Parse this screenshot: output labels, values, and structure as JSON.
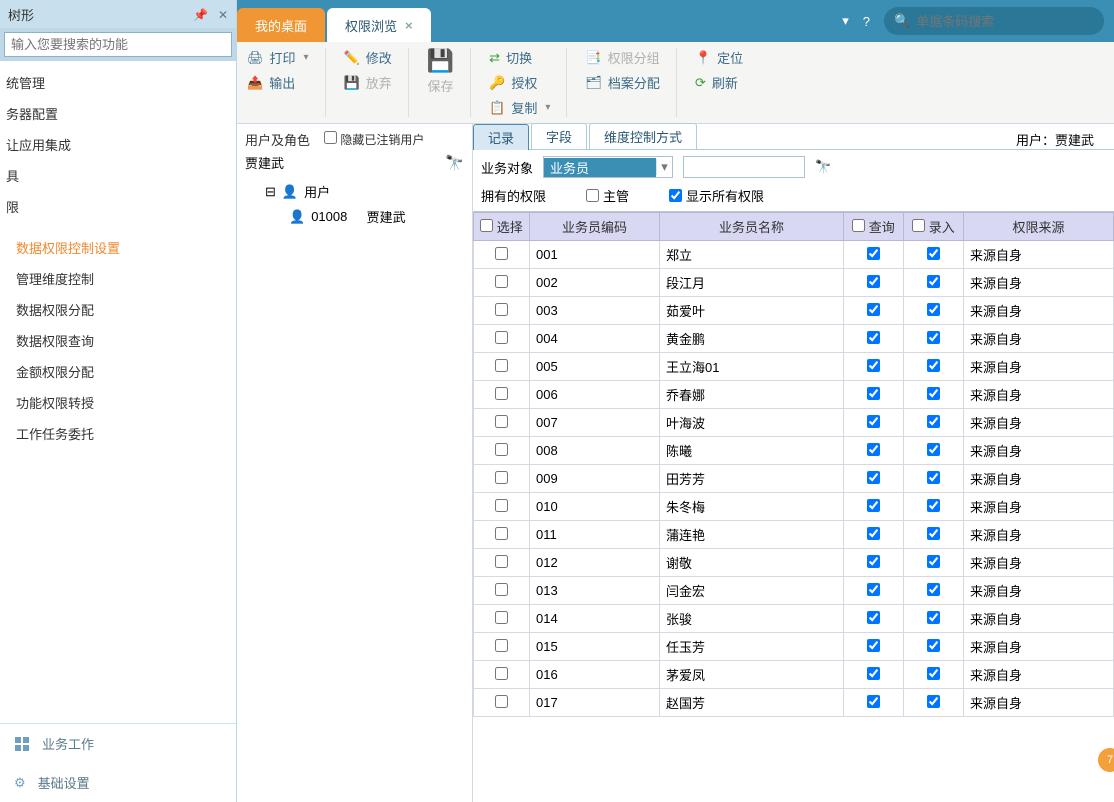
{
  "left_panel": {
    "title": "树形",
    "search_placeholder": "输入您要搜索的功能",
    "nav": [
      "统管理",
      "务器配置",
      "让应用集成",
      "具",
      "限"
    ],
    "sub_nav": [
      "数据权限控制设置",
      "管理维度控制",
      "数据权限分配",
      "数据权限查询",
      "金额权限分配",
      "功能权限转授",
      "工作任务委托"
    ],
    "active_sub": 0,
    "bottom": [
      "业务工作",
      "基础设置"
    ]
  },
  "top": {
    "tab1": "我的桌面",
    "tab2": "权限浏览",
    "search_placeholder": "单据条码搜索"
  },
  "toolbar": {
    "print": "打印",
    "export": "输出",
    "modify": "修改",
    "discard": "放弃",
    "save": "保存",
    "switch": "切换",
    "authorize": "授权",
    "copy": "复制",
    "perm_group": "权限分组",
    "archive_assign": "档案分配",
    "locate": "定位",
    "refresh": "刷新"
  },
  "tree": {
    "users_roles": "用户及角色",
    "hide_cancelled": "隐藏已注销用户",
    "current_user": "贾建武",
    "root": "用户",
    "child_code": "01008",
    "child_name": "贾建武"
  },
  "subtabs": {
    "record": "记录",
    "field": "字段",
    "dim": "维度控制方式"
  },
  "user_label_prefix": "用户：",
  "user_label_name": "贾建武",
  "filter": {
    "biz_object": "业务对象",
    "biz_selected": "业务员"
  },
  "owned": {
    "label": "拥有的权限",
    "supervisor": "主管",
    "show_all": "显示所有权限"
  },
  "headers": {
    "select": "选择",
    "code": "业务员编码",
    "name": "业务员名称",
    "query": "查询",
    "entry": "录入",
    "source": "权限来源"
  },
  "rows": [
    {
      "code": "001",
      "name": "郑立",
      "query": true,
      "entry": true,
      "source": "来源自身"
    },
    {
      "code": "002",
      "name": "段江月",
      "query": true,
      "entry": true,
      "source": "来源自身"
    },
    {
      "code": "003",
      "name": "茹爱叶",
      "query": true,
      "entry": true,
      "source": "来源自身"
    },
    {
      "code": "004",
      "name": "黄金鹏",
      "query": true,
      "entry": true,
      "source": "来源自身"
    },
    {
      "code": "005",
      "name": "王立海01",
      "query": true,
      "entry": true,
      "source": "来源自身"
    },
    {
      "code": "006",
      "name": "乔春娜",
      "query": true,
      "entry": true,
      "source": "来源自身"
    },
    {
      "code": "007",
      "name": "叶海波",
      "query": true,
      "entry": true,
      "source": "来源自身"
    },
    {
      "code": "008",
      "name": "陈曦",
      "query": true,
      "entry": true,
      "source": "来源自身"
    },
    {
      "code": "009",
      "name": "田芳芳",
      "query": true,
      "entry": true,
      "source": "来源自身"
    },
    {
      "code": "010",
      "name": "朱冬梅",
      "query": true,
      "entry": true,
      "source": "来源自身"
    },
    {
      "code": "011",
      "name": "蒲连艳",
      "query": true,
      "entry": true,
      "source": "来源自身"
    },
    {
      "code": "012",
      "name": "谢敬",
      "query": true,
      "entry": true,
      "source": "来源自身"
    },
    {
      "code": "013",
      "name": "闫金宏",
      "query": true,
      "entry": true,
      "source": "来源自身"
    },
    {
      "code": "014",
      "name": "张骏",
      "query": true,
      "entry": true,
      "source": "来源自身"
    },
    {
      "code": "015",
      "name": "任玉芳",
      "query": true,
      "entry": true,
      "source": "来源自身"
    },
    {
      "code": "016",
      "name": "茅爱凤",
      "query": true,
      "entry": true,
      "source": "来源自身"
    },
    {
      "code": "017",
      "name": "赵国芳",
      "query": true,
      "entry": true,
      "source": "来源自身"
    }
  ],
  "fab": "7"
}
